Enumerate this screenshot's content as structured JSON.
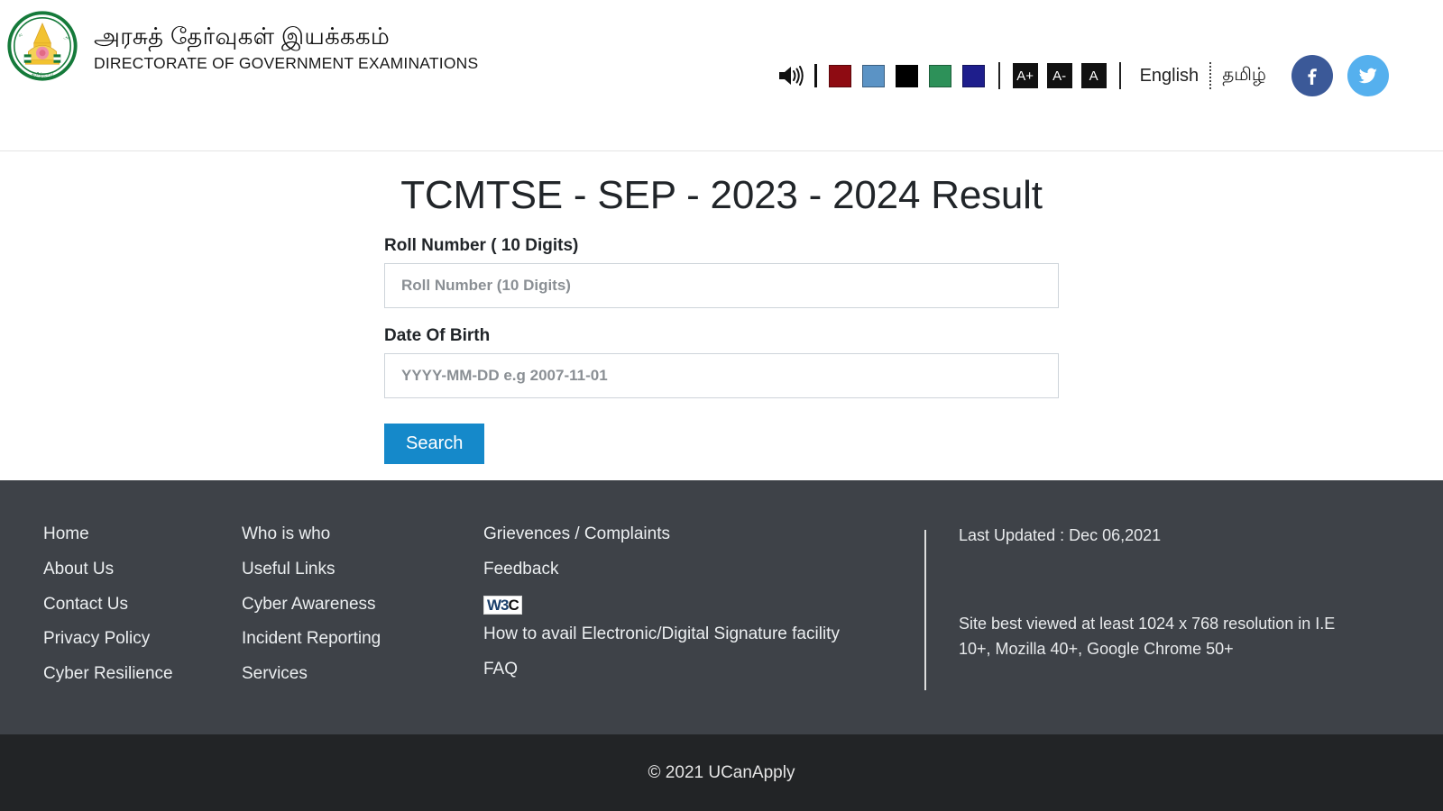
{
  "header": {
    "logo": {
      "icon": "tn-government-emblem",
      "title_tamil": "அரசுத் தேர்வுகள் இயக்ககம்",
      "title_english": "DIRECTORATE OF GOVERNMENT EXAMINATIONS"
    },
    "accessibility": {
      "speaker_icon": "speaker-icon",
      "theme_swatches": [
        {
          "name": "theme-dark-red",
          "color": "#8e0b12"
        },
        {
          "name": "theme-steel-blue",
          "color": "#5b93c5"
        },
        {
          "name": "theme-black",
          "color": "#000000"
        },
        {
          "name": "theme-green",
          "color": "#2d9159"
        },
        {
          "name": "theme-navy",
          "color": "#1e1e8c"
        }
      ],
      "font_buttons": [
        {
          "name": "font-increase",
          "label": "A+"
        },
        {
          "name": "font-decrease",
          "label": "A-"
        },
        {
          "name": "font-reset",
          "label": "A"
        }
      ],
      "languages": [
        {
          "name": "lang-english",
          "label": "English"
        },
        {
          "name": "lang-tamil",
          "label": "தமிழ்"
        }
      ],
      "social": [
        {
          "name": "facebook-icon",
          "label": "f",
          "color": "#3b5998"
        },
        {
          "name": "twitter-icon",
          "label": "t",
          "color": "#55b0ee"
        }
      ]
    }
  },
  "main": {
    "title": "TCMTSE - SEP - 2023 - 2024 Result",
    "fields": {
      "roll_number": {
        "label": "Roll Number ( 10 Digits)",
        "placeholder": "Roll Number (10 Digits)",
        "value": ""
      },
      "dob": {
        "label": "Date Of Birth",
        "placeholder": "YYYY-MM-DD e.g 2007-11-01",
        "value": ""
      }
    },
    "search_button": "Search",
    "accent_color": "#1589ca"
  },
  "footer": {
    "column1": [
      {
        "name": "footer-link-home",
        "label": "Home"
      },
      {
        "name": "footer-link-about-us",
        "label": "About Us"
      },
      {
        "name": "footer-link-contact-us",
        "label": "Contact Us"
      },
      {
        "name": "footer-link-privacy-policy",
        "label": "Privacy Policy"
      },
      {
        "name": "footer-link-cyber-resilience",
        "label": "Cyber Resilience"
      }
    ],
    "column2": [
      {
        "name": "footer-link-who-is-who",
        "label": "Who is who"
      },
      {
        "name": "footer-link-useful-links",
        "label": "Useful Links"
      },
      {
        "name": "footer-link-cyber-awareness",
        "label": "Cyber Awareness"
      },
      {
        "name": "footer-link-incident-reporting",
        "label": "Incident Reporting"
      },
      {
        "name": "footer-link-services",
        "label": "Services"
      }
    ],
    "column3": {
      "grievances": "Grievences / Complaints",
      "feedback": "Feedback",
      "w3c_badge": {
        "name": "w3c-validation-badge",
        "part1": "W3",
        "part2": "C"
      },
      "digital_signature": "How to avail Electronic/Digital Signature facility",
      "faq": "FAQ"
    },
    "column4": {
      "last_updated": "Last Updated : Dec 06,2021",
      "best_viewed": "Site best viewed at least 1024 x 768 resolution in I.E 10+, Mozilla 40+, Google Chrome 50+"
    },
    "copyright": "© 2021 UCanApply",
    "background": "#3e4248",
    "copybar_background": "#222426"
  }
}
